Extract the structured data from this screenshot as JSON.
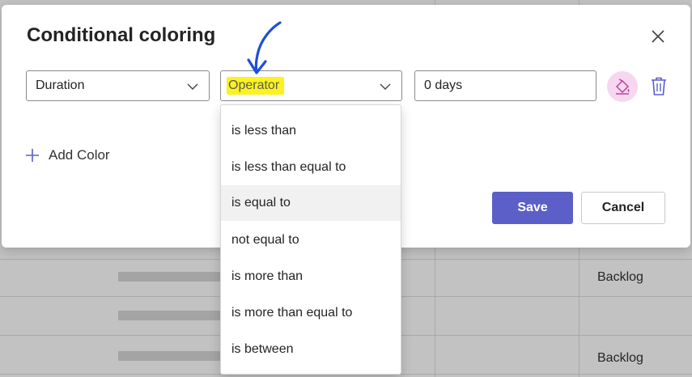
{
  "background": {
    "status_cells": [
      "Backlog",
      "Backlog"
    ]
  },
  "dialog": {
    "title": "Conditional coloring",
    "attribute_select": {
      "value": "Duration"
    },
    "operator_select": {
      "placeholder": "Operator",
      "highlight_color": "#fbf21f"
    },
    "value_input": {
      "value": "0 days"
    },
    "add_color_label": "Add Color",
    "save_label": "Save",
    "cancel_label": "Cancel",
    "accent_color": "#5b5fc7",
    "color_button_bg": "#f7d6f0"
  },
  "operator_options": [
    "is less than",
    "is less than equal to",
    "is equal to",
    "not equal to",
    "is more than",
    "is more than equal to",
    "is between"
  ],
  "hovered_option": "is equal to",
  "icons": [
    "close-icon",
    "chevron-down-icon",
    "paint-bucket-icon",
    "trash-icon",
    "plus-icon",
    "arrow-annotation-icon"
  ]
}
